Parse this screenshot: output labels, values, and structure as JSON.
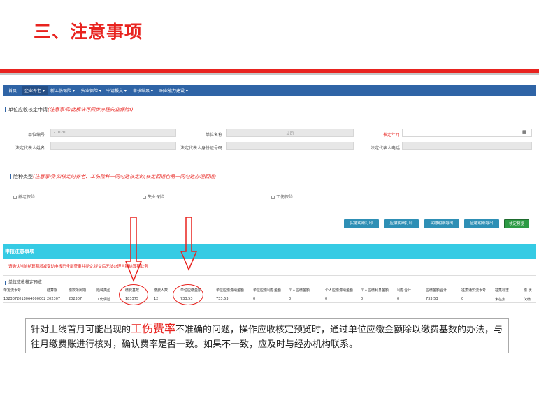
{
  "slide": {
    "title": "三、注意事项"
  },
  "nav": {
    "items": [
      "首页",
      "企业养老 ▾",
      "新工伤保险 ▾",
      "失业保险 ▾",
      "申请报文 ▾",
      "审核结果 ▾",
      "职业能力建设 ▾"
    ],
    "active_index": 1
  },
  "section1": {
    "title": "单位应收核定申请",
    "note": "(注意事项:此模块可同步办理失业保险!)"
  },
  "form": {
    "unit_code_label": "单位编号",
    "unit_code_value": "21020",
    "unit_name_label": "单位名称",
    "unit_name_value": "公司",
    "verify_month_label": "核定年月",
    "verify_month_value": "",
    "legal_name_label": "法定代表人姓名",
    "legal_id_label": "法定代表人身份证号码",
    "legal_phone_label": "法定代表人电话"
  },
  "section2": {
    "title": "险种类型",
    "note": "(注意事项:如核定时养老、工伤险种一同勾选核定的,核定回退也需一同勾选办理回退)"
  },
  "insurance": {
    "pension": "养老保险",
    "unemployment": "失业保险",
    "injury": "工伤保险"
  },
  "buttons": {
    "b1": "实缴明细打印",
    "b2": "应缴明细打印",
    "b3": "实缴明细导出",
    "b4": "应缴明细导出",
    "b5": "核定预览"
  },
  "notice": {
    "header": "申报注意事项",
    "text": "请确认当前结算期增减变动申报已全部获审并提交,提交后无法办理当期结算期业务"
  },
  "preview": {
    "title": "单位应收核定预览",
    "columns": [
      "单定流水号",
      "结算期",
      "缴款所属期",
      "险种类型",
      "缴费基数",
      "缴费人数",
      "单位应缴金额",
      "单位应缴滞纳金额",
      "单位应缴利息金额",
      "个人应缴金额",
      "个人应缴滞纳金额",
      "个人应缴利息金额",
      "利息合计",
      "应缴金额合计",
      "征集通知流水号",
      "征集标志",
      "缴 状"
    ],
    "row": [
      "1023072013064000002",
      "202307",
      "202307",
      "工伤保险",
      "183375",
      "12",
      "733.53",
      "733.53",
      "0",
      "0",
      "0",
      "0",
      "0",
      "733.53",
      "0",
      "未征集",
      "欠缴"
    ]
  },
  "caption": {
    "before": "针对上线首月可能出现的",
    "highlight": "工伤费率",
    "after": "不准确的问题，操作应收核定预览时，通过单位应缴金额除以缴费基数的办法，与往月缴费账进行核对，确认费率是否一致。如果不一致，应及时与经办机构联系。"
  },
  "colors": {
    "accent_red": "#e8231f",
    "nav_blue": "#2f64a6",
    "notice_cyan": "#35cbe4",
    "button_teal": "#2e8fb5",
    "button_green": "#2d9a44"
  }
}
